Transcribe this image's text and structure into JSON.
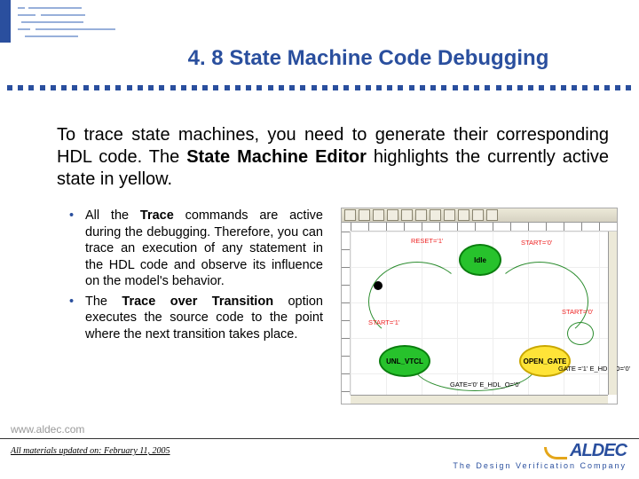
{
  "title": "4. 8 State Machine Code Debugging",
  "intro_parts": {
    "p1": "To trace state machines, you need to generate their corresponding HDL code.  The ",
    "p2": "State Machine Editor",
    "p3": " highlights the currently active state in yellow."
  },
  "bullets": [
    {
      "pre": "All the ",
      "bold": "Trace",
      "post": " commands are active during the debugging. Therefore, you can trace an execution of any statement in the HDL code and observe its influence on the model's behavior."
    },
    {
      "pre": "The ",
      "bold": "Trace over Transition",
      "post": " option executes the source code to the point where the next transition takes place."
    }
  ],
  "diagram": {
    "states": {
      "idle": "Idle",
      "unlv": "UNL_VTCL",
      "open": "OPEN_GATE"
    },
    "labels": {
      "reset": "RESET='1'",
      "start0": "START='0'",
      "start1": "START='1'",
      "start0_b": "START='0'",
      "open_guard": "GATE ='1'\nE_HDL_O='0'",
      "unlv_guard": "GATE='0'\nE_HDL_O='0'"
    }
  },
  "footer": {
    "website": "www.aldec.com",
    "updated": "All materials updated on: February 11, 2005",
    "brand": "ALDEC",
    "tagline": "The Design Verification Company"
  }
}
